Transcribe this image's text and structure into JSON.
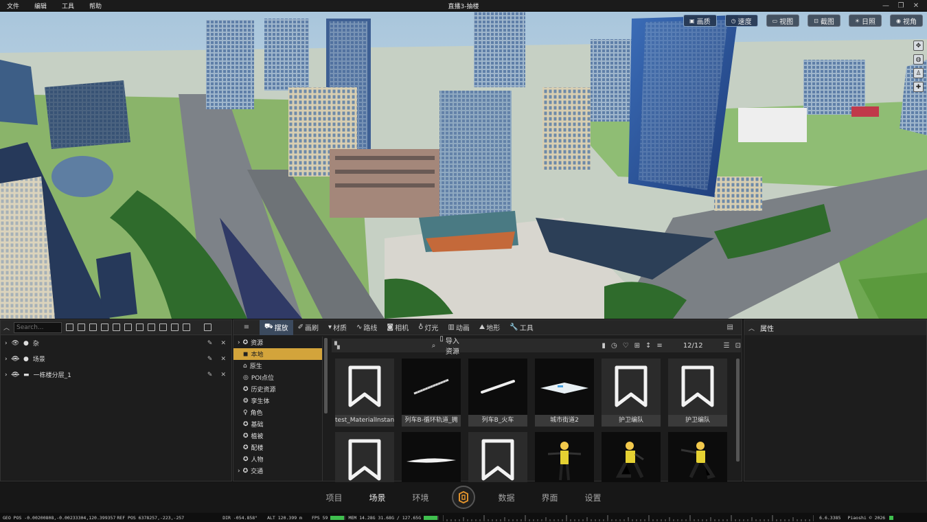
{
  "titlebar": {
    "menus": [
      "文件",
      "编辑",
      "工具",
      "帮助"
    ],
    "title": "直播3-抽楼"
  },
  "viewport_toolbar": [
    {
      "label": "画质",
      "icon": "quality-icon",
      "active": true
    },
    {
      "label": "速度",
      "icon": "speed-icon",
      "active": true
    },
    {
      "label": "视图",
      "icon": "view-icon",
      "active": false
    },
    {
      "label": "截图",
      "icon": "screenshot-icon",
      "active": false
    },
    {
      "label": "日照",
      "icon": "sun-icon",
      "active": false
    },
    {
      "label": "视角",
      "icon": "eye-icon",
      "active": false
    }
  ],
  "hierarchy": {
    "search_placeholder": "Search...",
    "items": [
      {
        "label": "杂",
        "visible": true,
        "icon": "light-icon"
      },
      {
        "label": "场景",
        "visible": false,
        "icon": "light-icon"
      },
      {
        "label": "一栋楼分层_1",
        "visible": false,
        "icon": "layer-icon"
      }
    ]
  },
  "asset_panel": {
    "tabs": [
      {
        "label": "摆放",
        "icon": "place-icon",
        "active": true
      },
      {
        "label": "画刷",
        "icon": "brush-icon",
        "active": false
      },
      {
        "label": "材质",
        "icon": "material-icon",
        "active": false
      },
      {
        "label": "路线",
        "icon": "route-icon",
        "active": false
      },
      {
        "label": "相机",
        "icon": "camera-icon",
        "active": false
      },
      {
        "label": "灯光",
        "icon": "bulb-icon",
        "active": false
      },
      {
        "label": "动画",
        "icon": "animation-icon",
        "active": false
      },
      {
        "label": "地形",
        "icon": "terrain-icon",
        "active": false
      },
      {
        "label": "工具",
        "icon": "wrench-icon",
        "active": false
      }
    ],
    "categories": [
      {
        "label": "资源",
        "expandable": true,
        "selected": false
      },
      {
        "label": "本地",
        "expandable": false,
        "selected": true
      },
      {
        "label": "原生",
        "expandable": false,
        "selected": false
      },
      {
        "label": "POI点位",
        "expandable": false,
        "selected": false
      },
      {
        "label": "历史资源",
        "expandable": false,
        "selected": false
      },
      {
        "label": "孪生体",
        "expandable": false,
        "selected": false
      },
      {
        "label": "角色",
        "expandable": false,
        "selected": false
      },
      {
        "label": "基础",
        "expandable": false,
        "selected": false
      },
      {
        "label": "植被",
        "expandable": false,
        "selected": false
      },
      {
        "label": "配楼",
        "expandable": false,
        "selected": false
      },
      {
        "label": "人物",
        "expandable": false,
        "selected": false
      },
      {
        "label": "交通",
        "expandable": true,
        "selected": false
      }
    ],
    "import_label": "导入资源",
    "count": "12/12",
    "assets": [
      {
        "label": "test_MaterialInstan",
        "thumb": "bookmark"
      },
      {
        "label": "列车B-循环轨道_拥",
        "thumb": "rail"
      },
      {
        "label": "列车B_火车",
        "thumb": "train"
      },
      {
        "label": "城市街道2",
        "thumb": "street"
      },
      {
        "label": "护卫编队",
        "thumb": "bookmark"
      },
      {
        "label": "护卫编队",
        "thumb": "bookmark"
      },
      {
        "label": "",
        "thumb": "bookmark"
      },
      {
        "label": "",
        "thumb": "blade"
      },
      {
        "label": "",
        "thumb": "bookmark"
      },
      {
        "label": "",
        "thumb": "worker-stand"
      },
      {
        "label": "",
        "thumb": "worker-kneel"
      },
      {
        "label": "",
        "thumb": "worker-point"
      }
    ]
  },
  "properties": {
    "title": "属性"
  },
  "bottom_nav": {
    "left": [
      {
        "label": "项目",
        "active": false
      },
      {
        "label": "场景",
        "active": true
      },
      {
        "label": "环境",
        "active": false
      }
    ],
    "right": [
      {
        "label": "数据",
        "active": false
      },
      {
        "label": "界面",
        "active": false
      },
      {
        "label": "设置",
        "active": false
      }
    ]
  },
  "status": {
    "geo": "GEO POS  -0.00200808,-0.00233304,120.399357",
    "ref": "REF POS 6378257,-223,-257",
    "dir": "DIR  -054.858°",
    "alt": "ALT  120.399 m",
    "fps": "FPS  59",
    "fps_level": 0.9,
    "mem": "MEM  14.28G  31.68G / 127.65G",
    "mem_level": 0.9,
    "version": "6.6.3385",
    "copyright": "Piaoshi © 2026"
  },
  "colors": {
    "accent": "#d3a43b",
    "tab_active": "#3b4a5e",
    "panel": "#1d1d1d"
  }
}
